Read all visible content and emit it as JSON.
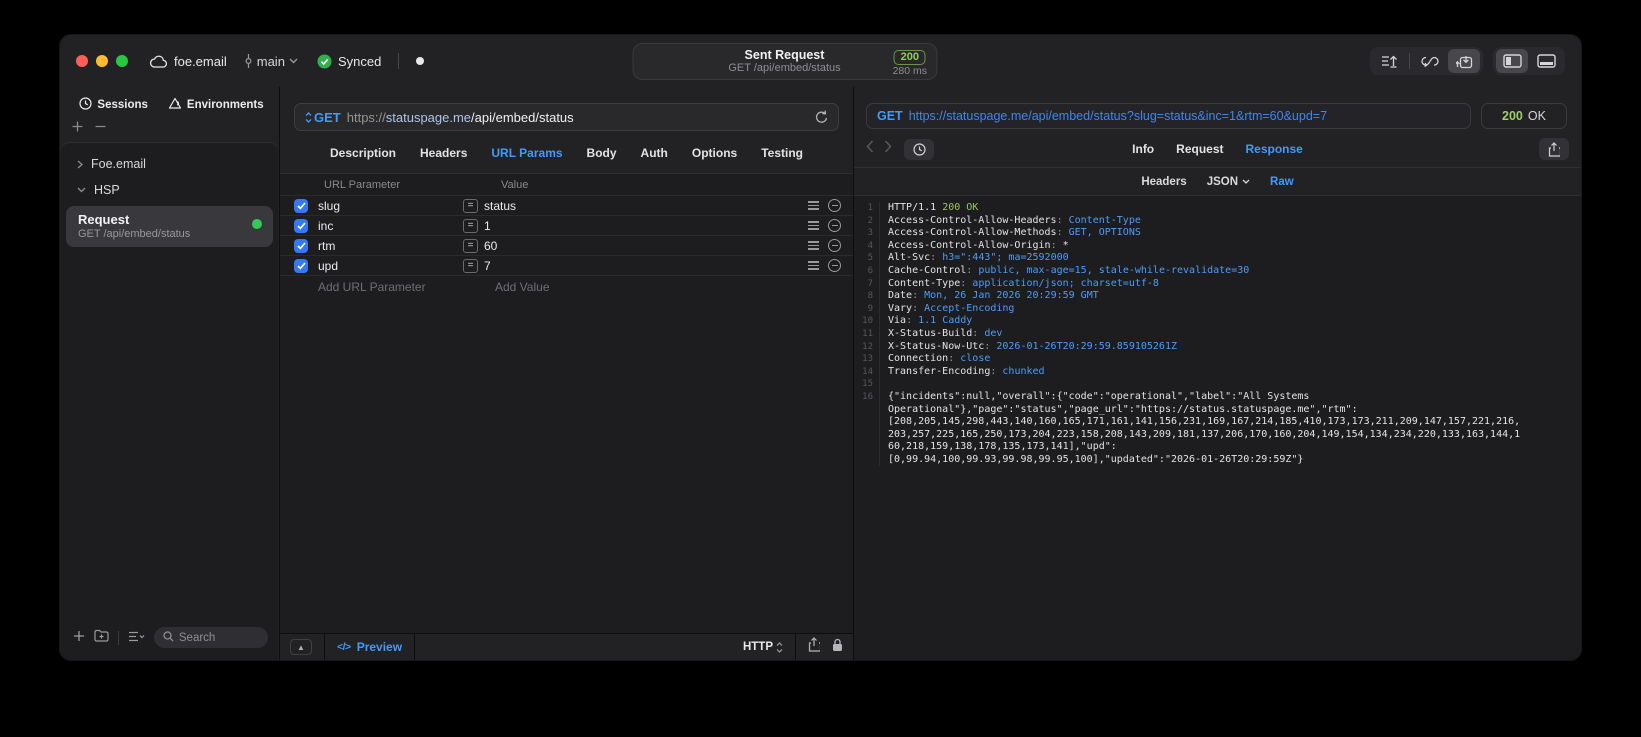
{
  "titlebar": {
    "project": "foe.email",
    "branch": "main",
    "sync_status": "Synced",
    "request_title": "Sent Request",
    "request_subtitle": "GET /api/embed/status",
    "status_code": "200",
    "duration": "280 ms"
  },
  "sidebar": {
    "tabs": [
      {
        "label": "Sessions"
      },
      {
        "label": "Environments"
      }
    ],
    "tree": [
      {
        "label": "Foe.email"
      },
      {
        "label": "HSP"
      },
      {
        "label": "Request",
        "subtitle": "GET /api/embed/status"
      }
    ],
    "search_placeholder": "Search"
  },
  "request_panel": {
    "method": "GET",
    "url_scheme": "https://",
    "url_host": "statuspage.me",
    "url_path": "/api/embed/status",
    "tabs": [
      "Description",
      "Headers",
      "URL Params",
      "Body",
      "Auth",
      "Options",
      "Testing"
    ],
    "active_tab": "URL Params",
    "param_table": {
      "columns": [
        "URL Parameter",
        "Value"
      ],
      "rows": [
        {
          "name": "slug",
          "value": "status",
          "enabled": true
        },
        {
          "name": "inc",
          "value": "1",
          "enabled": true
        },
        {
          "name": "rtm",
          "value": "60",
          "enabled": true
        },
        {
          "name": "upd",
          "value": "7",
          "enabled": true
        }
      ],
      "add_name_placeholder": "Add URL Parameter",
      "add_value_placeholder": "Add Value"
    },
    "footer": {
      "preview_label": "Preview",
      "code_glyph": "</>",
      "protocol": "HTTP"
    }
  },
  "response_panel": {
    "request_method": "GET",
    "request_url": "https://statuspage.me/api/embed/status?slug=status&inc=1&rtm=60&upd=7",
    "status_code": "200",
    "status_text": "OK",
    "tabs": [
      "Info",
      "Request",
      "Response"
    ],
    "active_tab": "Response",
    "subtabs": [
      "Headers",
      "JSON",
      "Raw"
    ],
    "active_subtab": "Raw",
    "body_lines": [
      {
        "n": "1",
        "segs": [
          {
            "t": "HTTP/1.1 ",
            "c": "w"
          },
          {
            "t": "200 OK",
            "c": "g"
          }
        ]
      },
      {
        "n": "2",
        "segs": [
          {
            "t": "Access-Control-Allow-Headers",
            "c": "w"
          },
          {
            "t": ": ",
            "c": "d"
          },
          {
            "t": "Content-Type",
            "c": "b"
          }
        ]
      },
      {
        "n": "3",
        "segs": [
          {
            "t": "Access-Control-Allow-Methods",
            "c": "w"
          },
          {
            "t": ": ",
            "c": "d"
          },
          {
            "t": "GET, OPTIONS",
            "c": "b"
          }
        ]
      },
      {
        "n": "4",
        "segs": [
          {
            "t": "Access-Control-Allow-Origin",
            "c": "w"
          },
          {
            "t": ": ",
            "c": "d"
          },
          {
            "t": "*",
            "c": "w"
          }
        ]
      },
      {
        "n": "5",
        "segs": [
          {
            "t": "Alt-Svc",
            "c": "w"
          },
          {
            "t": ": ",
            "c": "d"
          },
          {
            "t": "h3=\":443\"; ma=2592000",
            "c": "b"
          }
        ]
      },
      {
        "n": "6",
        "segs": [
          {
            "t": "Cache-Control",
            "c": "w"
          },
          {
            "t": ": ",
            "c": "d"
          },
          {
            "t": "public, max-age=15, stale-while-revalidate=30",
            "c": "b"
          }
        ]
      },
      {
        "n": "7",
        "segs": [
          {
            "t": "Content-Type",
            "c": "w"
          },
          {
            "t": ": ",
            "c": "d"
          },
          {
            "t": "application/json; charset=utf-8",
            "c": "b"
          }
        ]
      },
      {
        "n": "8",
        "segs": [
          {
            "t": "Date",
            "c": "w"
          },
          {
            "t": ": ",
            "c": "d"
          },
          {
            "t": "Mon, 26 Jan 2026 20:29:59 GMT",
            "c": "b"
          }
        ]
      },
      {
        "n": "9",
        "segs": [
          {
            "t": "Vary",
            "c": "w"
          },
          {
            "t": ": ",
            "c": "d"
          },
          {
            "t": "Accept-Encoding",
            "c": "b"
          }
        ]
      },
      {
        "n": "10",
        "segs": [
          {
            "t": "Via",
            "c": "w"
          },
          {
            "t": ": ",
            "c": "d"
          },
          {
            "t": "1.1 Caddy",
            "c": "b"
          }
        ]
      },
      {
        "n": "11",
        "segs": [
          {
            "t": "X-Status-Build",
            "c": "w"
          },
          {
            "t": ": ",
            "c": "d"
          },
          {
            "t": "dev",
            "c": "b"
          }
        ]
      },
      {
        "n": "12",
        "segs": [
          {
            "t": "X-Status-Now-Utc",
            "c": "w"
          },
          {
            "t": ": ",
            "c": "d"
          },
          {
            "t": "2026-01-26T20:29:59.859105261Z",
            "c": "b"
          }
        ]
      },
      {
        "n": "13",
        "segs": [
          {
            "t": "Connection",
            "c": "w"
          },
          {
            "t": ": ",
            "c": "d"
          },
          {
            "t": "close",
            "c": "b"
          }
        ]
      },
      {
        "n": "14",
        "segs": [
          {
            "t": "Transfer-Encoding",
            "c": "w"
          },
          {
            "t": ": ",
            "c": "d"
          },
          {
            "t": "chunked",
            "c": "b"
          }
        ]
      },
      {
        "n": "15",
        "segs": []
      },
      {
        "n": "16",
        "segs": [
          {
            "t": "{\"incidents\":null,\"overall\":{\"code\":\"operational\",\"label\":\"All Systems",
            "c": "w"
          }
        ]
      },
      {
        "n": "",
        "segs": [
          {
            "t": "Operational\"},\"page\":\"status\",\"page_url\":\"https://status.statuspage.me\",\"rtm\":",
            "c": "w"
          }
        ]
      },
      {
        "n": "",
        "segs": [
          {
            "t": "[208,205,145,298,443,140,160,165,171,161,141,156,231,169,167,214,185,410,173,173,211,209,147,157,221,216,",
            "c": "w"
          }
        ]
      },
      {
        "n": "",
        "segs": [
          {
            "t": "203,257,225,165,250,173,204,223,158,208,143,209,181,137,206,170,160,204,149,154,134,234,220,133,163,144,1",
            "c": "w"
          }
        ]
      },
      {
        "n": "",
        "segs": [
          {
            "t": "60,218,159,138,178,135,173,141],\"upd\":",
            "c": "w"
          }
        ]
      },
      {
        "n": "",
        "segs": [
          {
            "t": "[0,99.94,100,99.93,99.98,99.95,100],\"updated\":\"2026-01-26T20:29:59Z\"}",
            "c": "w"
          }
        ]
      }
    ]
  }
}
